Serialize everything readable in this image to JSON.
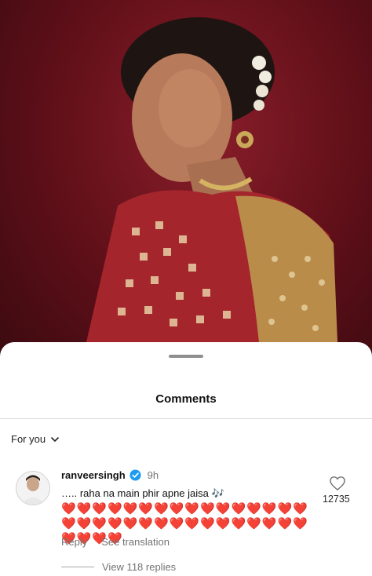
{
  "photo": {
    "description_icon": "photo-post"
  },
  "sheet": {
    "title": "Comments",
    "filter_label": "For you"
  },
  "comment": {
    "username": "ranveersingh",
    "time": "9h",
    "text": "….. raha na main phir apne jaisa 🎶",
    "hearts": "❤️❤️❤️❤️❤️❤️❤️❤️❤️❤️❤️❤️❤️❤️❤️❤️❤️❤️❤️❤️❤️❤️❤️❤️❤️❤️❤️❤️❤️❤️❤️❤️❤️❤️❤️❤️",
    "reply_label": "Reply",
    "translate_label": "See translation",
    "like_count": "12735",
    "replies_label": "View 118 replies"
  },
  "colors": {
    "heart": "#e0202f",
    "verified": "#1d9bf0",
    "muted_text": "#737373",
    "photo_bg": "#5e0f18"
  }
}
